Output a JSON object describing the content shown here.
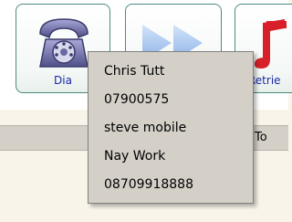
{
  "toolbar": {
    "buttons": [
      {
        "label": "Dia",
        "icon": "telephone-icon"
      },
      {
        "label": "",
        "icon": "forward-arrows-icon"
      },
      {
        "label": "Retrie",
        "icon": "music-note-icon"
      }
    ]
  },
  "strip": {
    "text": "To"
  },
  "popup": {
    "items": [
      {
        "label": "Chris Tutt"
      },
      {
        "label": "07900575"
      },
      {
        "label": "steve mobile"
      },
      {
        "label": "Nay Work"
      },
      {
        "label": "08709918888"
      }
    ]
  },
  "colors": {
    "button_border": "#4c8a82",
    "button_label": "#1a2aa8",
    "menu_background": "#d4d0c8",
    "page_background": "#f8f4ea"
  }
}
